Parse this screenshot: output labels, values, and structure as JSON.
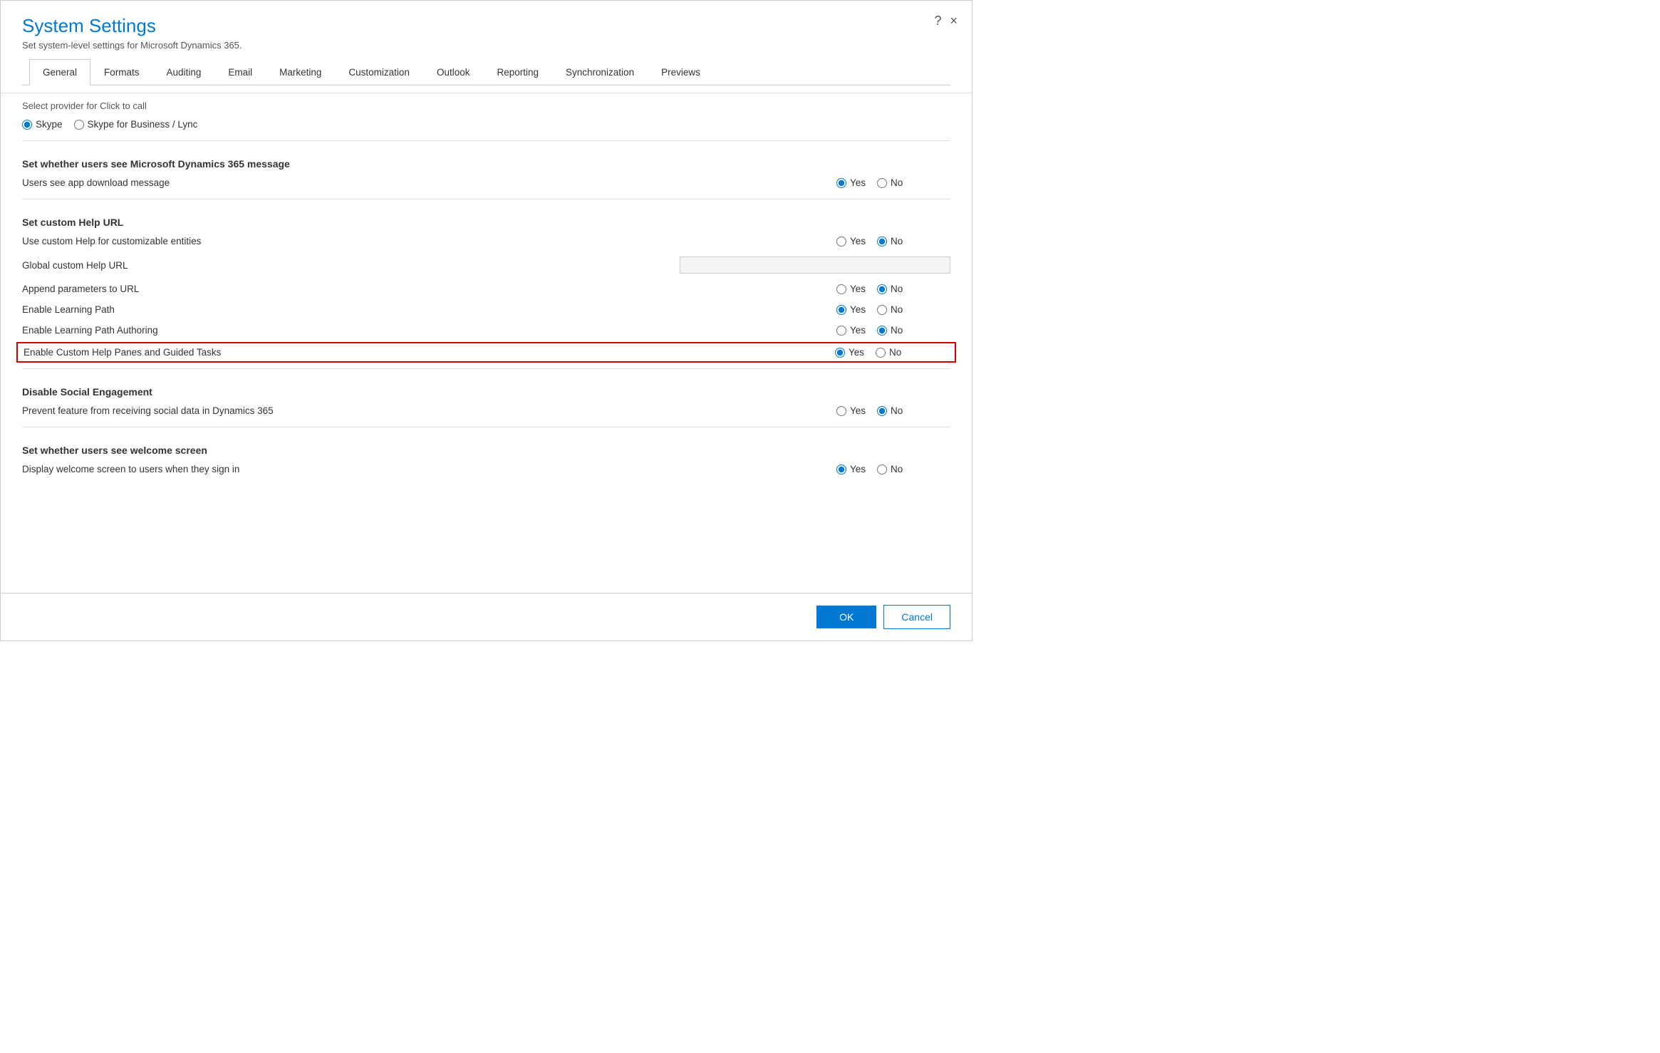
{
  "dialog": {
    "title": "System Settings",
    "subtitle": "Set system-level settings for Microsoft Dynamics 365.",
    "close_label": "×",
    "help_label": "?"
  },
  "tabs": [
    {
      "id": "general",
      "label": "General",
      "active": true
    },
    {
      "id": "formats",
      "label": "Formats",
      "active": false
    },
    {
      "id": "auditing",
      "label": "Auditing",
      "active": false
    },
    {
      "id": "email",
      "label": "Email",
      "active": false
    },
    {
      "id": "marketing",
      "label": "Marketing",
      "active": false
    },
    {
      "id": "customization",
      "label": "Customization",
      "active": false
    },
    {
      "id": "outlook",
      "label": "Outlook",
      "active": false
    },
    {
      "id": "reporting",
      "label": "Reporting",
      "active": false
    },
    {
      "id": "synchronization",
      "label": "Synchronization",
      "active": false
    },
    {
      "id": "previews",
      "label": "Previews",
      "active": false
    }
  ],
  "sections": {
    "click_to_call": {
      "label": "Select provider for Click to call",
      "options": [
        {
          "id": "skype",
          "label": "Skype",
          "checked": true
        },
        {
          "id": "skype-business",
          "label": "Skype for Business / Lync",
          "checked": false
        }
      ]
    },
    "microsoft_message": {
      "header": "Set whether users see Microsoft Dynamics 365 message",
      "rows": [
        {
          "label": "Users see app download message",
          "yes_checked": true,
          "no_checked": false
        }
      ]
    },
    "custom_help": {
      "header": "Set custom Help URL",
      "rows": [
        {
          "id": "use-custom-help",
          "label": "Use custom Help for customizable entities",
          "yes_checked": false,
          "no_checked": true,
          "has_input": false
        },
        {
          "id": "global-custom-help-url",
          "label": "Global custom Help URL",
          "has_input": true
        },
        {
          "id": "append-parameters",
          "label": "Append parameters to URL",
          "yes_checked": false,
          "no_checked": true,
          "has_input": false
        },
        {
          "id": "enable-learning-path",
          "label": "Enable Learning Path",
          "yes_checked": true,
          "no_checked": false,
          "has_input": false
        },
        {
          "id": "enable-learning-path-authoring",
          "label": "Enable Learning Path Authoring",
          "yes_checked": false,
          "no_checked": true,
          "has_input": false
        },
        {
          "id": "enable-custom-help-panes",
          "label": "Enable Custom Help Panes and Guided Tasks",
          "yes_checked": true,
          "no_checked": false,
          "highlighted": true,
          "has_input": false
        }
      ]
    },
    "social_engagement": {
      "header": "Disable Social Engagement",
      "rows": [
        {
          "label": "Prevent feature from receiving social data in Dynamics 365",
          "yes_checked": false,
          "no_checked": true
        }
      ]
    },
    "welcome_screen": {
      "header": "Set whether users see welcome screen",
      "rows": [
        {
          "label": "Display welcome screen to users when they sign in",
          "yes_checked": true,
          "no_checked": false
        }
      ]
    }
  },
  "footer": {
    "ok_label": "OK",
    "cancel_label": "Cancel"
  }
}
